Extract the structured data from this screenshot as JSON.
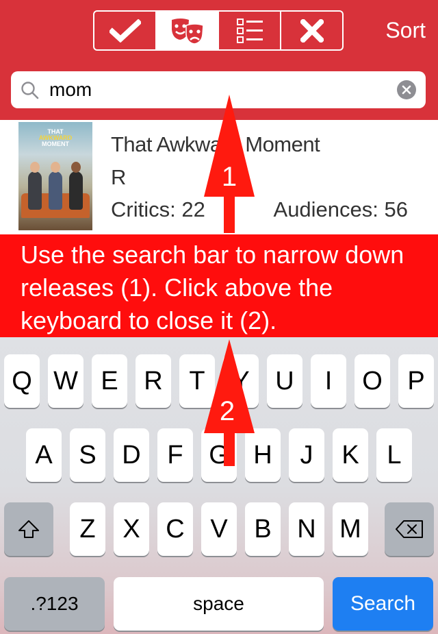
{
  "colors": {
    "header_bg": "#d8323a",
    "banner_bg": "#ff0d0d",
    "arrow": "#ff1a0f",
    "search_key": "#1e7ff2"
  },
  "header": {
    "filter_tabs": [
      {
        "icon": "checkmark-icon",
        "active": false
      },
      {
        "icon": "theater-masks-icon",
        "active": true
      },
      {
        "icon": "list-icon",
        "active": false
      },
      {
        "icon": "close-x-icon",
        "active": false
      }
    ],
    "sort_label": "Sort"
  },
  "search": {
    "value": "mom",
    "icon": "search-icon",
    "clear_icon": "clear-icon"
  },
  "movie": {
    "title": "That Awkward Moment",
    "rating": "R",
    "critics_label": "Critics: 22",
    "audiences_label": "Audiences: 56",
    "poster_line1": "THAT",
    "poster_line2": "AWKWARD",
    "poster_line3": "MOMENT"
  },
  "tutorial": {
    "text": "Use the search bar to narrow down releases (1). Click above the keyboard to close it (2).",
    "arrow1_label": "1",
    "arrow2_label": "2"
  },
  "keyboard": {
    "row1": [
      "Q",
      "W",
      "E",
      "R",
      "T",
      "Y",
      "U",
      "I",
      "O",
      "P"
    ],
    "row2": [
      "A",
      "S",
      "D",
      "F",
      "G",
      "H",
      "J",
      "K",
      "L"
    ],
    "row3": [
      "Z",
      "X",
      "C",
      "V",
      "B",
      "N",
      "M"
    ],
    "numbers_label": ".?123",
    "space_label": "space",
    "return_label": "Search"
  }
}
